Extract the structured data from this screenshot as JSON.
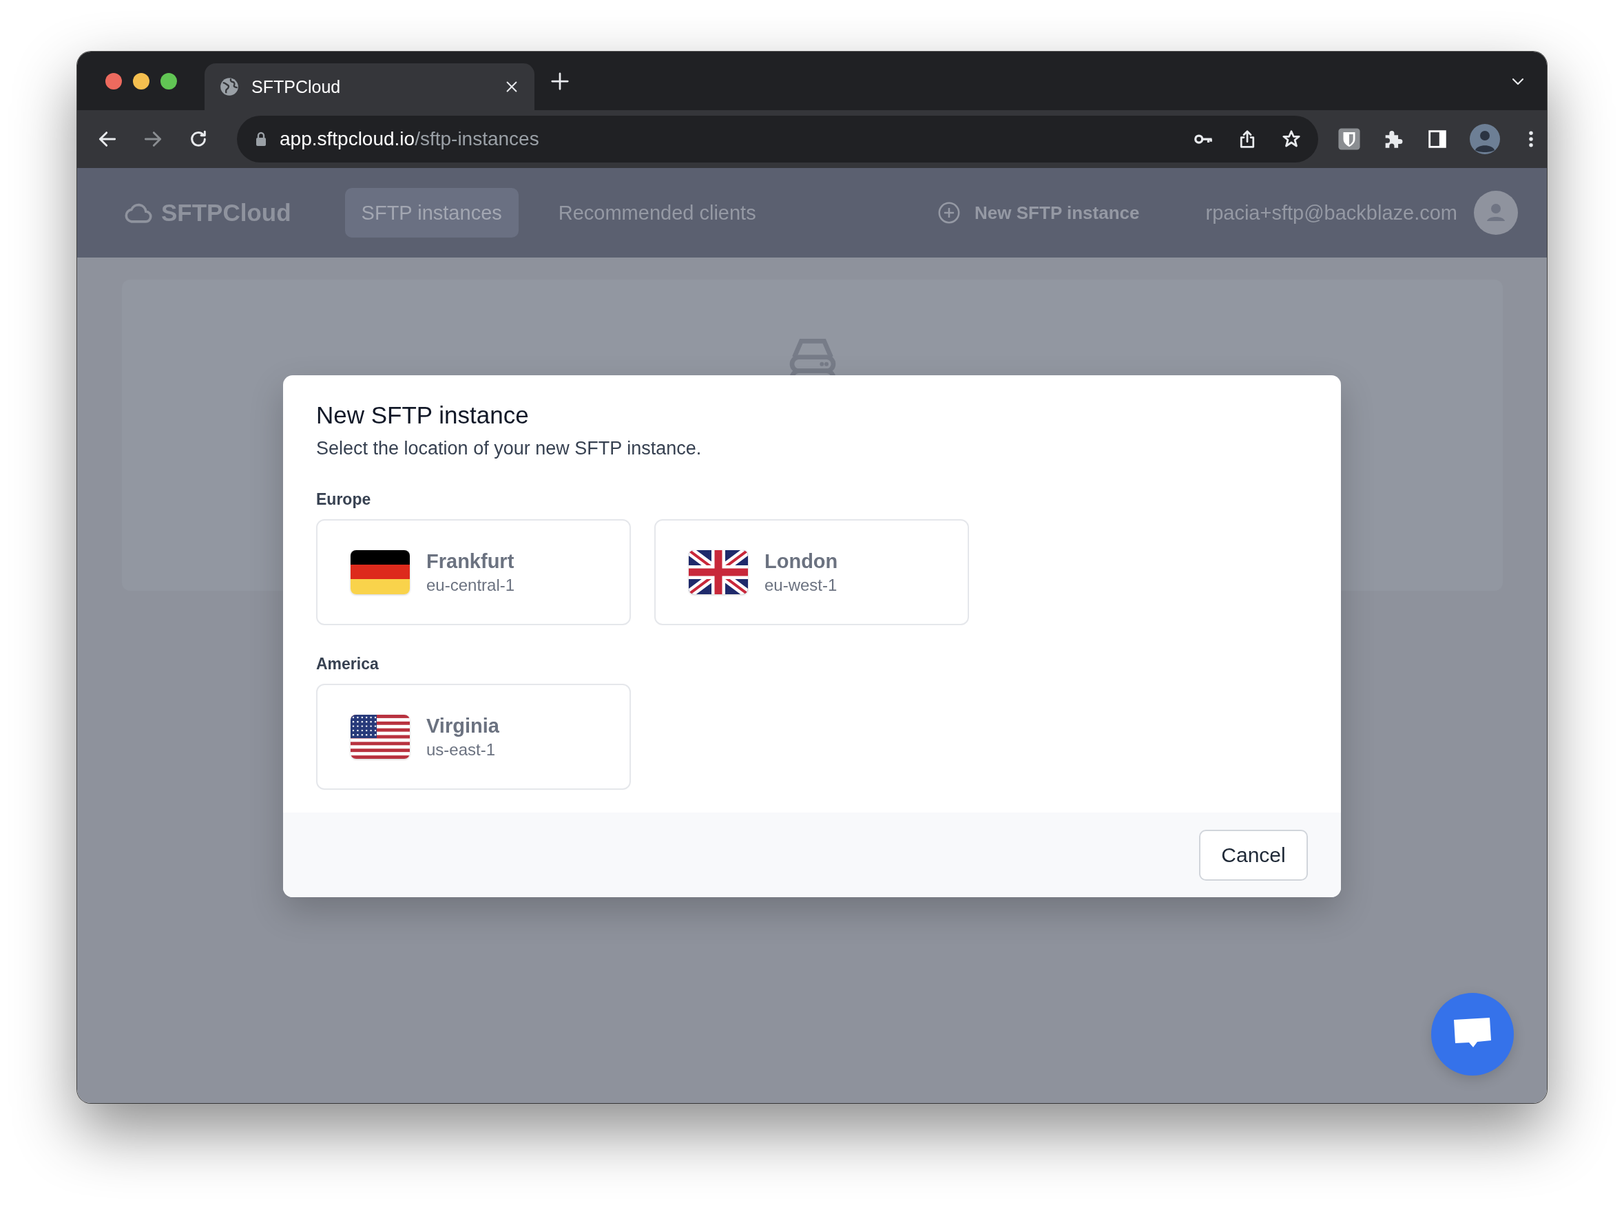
{
  "browser": {
    "tab_title": "SFTPCloud",
    "url_host": "app.sftpcloud.io",
    "url_path": "/sftp-instances"
  },
  "nav": {
    "logo": "SFTPCloud",
    "links": [
      {
        "label": "SFTP instances",
        "selected": true
      },
      {
        "label": "Recommended clients",
        "selected": false
      }
    ],
    "new_button": "New SFTP instance",
    "user_email": "rpacia+sftp@backblaze.com"
  },
  "modal": {
    "title": "New SFTP instance",
    "subtitle": "Select the location of your new SFTP instance.",
    "groups": [
      {
        "label": "Europe",
        "locations": [
          {
            "city": "Frankfurt",
            "region": "eu-central-1",
            "kind": "germany"
          },
          {
            "city": "London",
            "region": "eu-west-1",
            "kind": "uk"
          }
        ]
      },
      {
        "label": "America",
        "locations": [
          {
            "city": "Virginia",
            "region": "us-east-1",
            "kind": "usa"
          }
        ]
      }
    ],
    "cancel": "Cancel"
  }
}
